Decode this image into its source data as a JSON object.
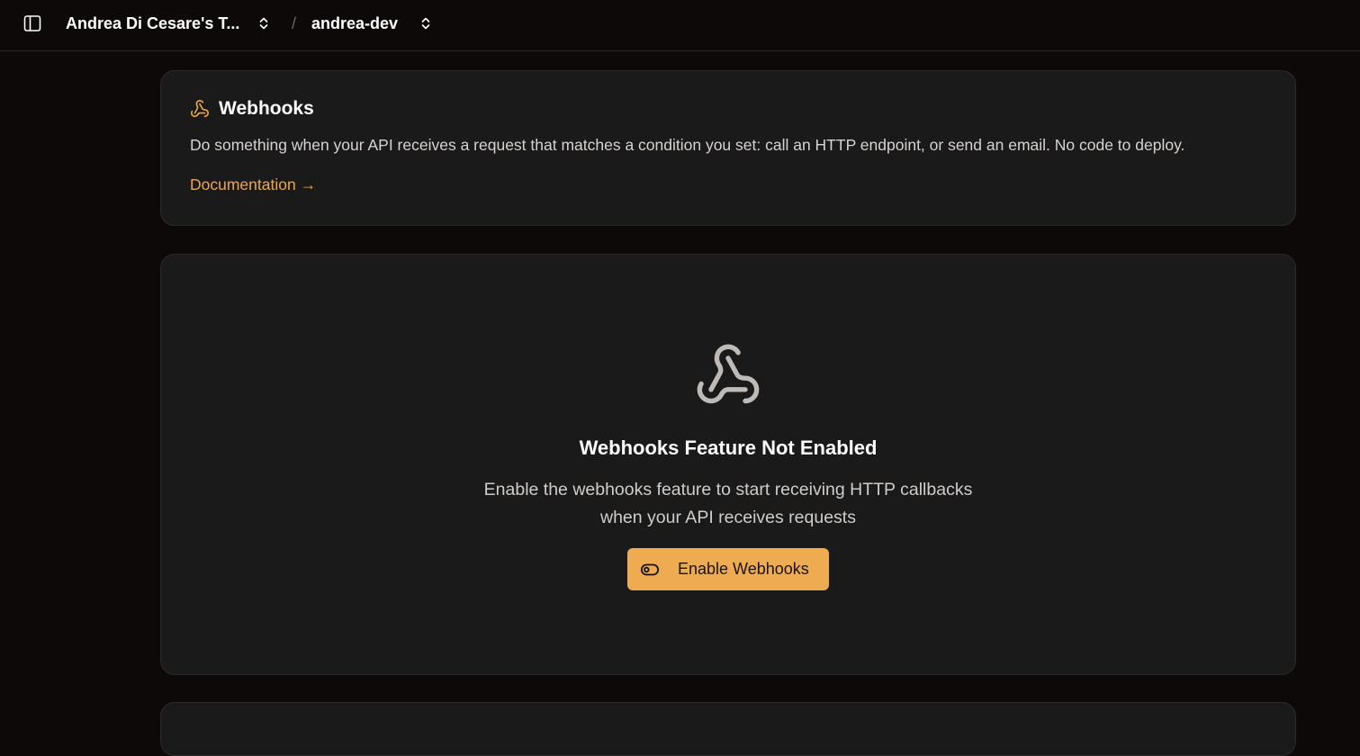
{
  "header": {
    "team_name": "Andrea Di Cesare's T...",
    "separator": "/",
    "project_name": "andrea-dev",
    "icons": [
      "sidebar-toggle-icon",
      "chevron-up-down-icon"
    ]
  },
  "info_card": {
    "title": "Webhooks",
    "description": "Do something when your API receives a request that matches a condition you set: call an HTTP endpoint, or send an email. No code to deploy.",
    "documentation_link": "Documentation →",
    "icon": "webhook-icon"
  },
  "empty_state": {
    "title": "Webhooks Feature Not Enabled",
    "description": "Enable the webhooks feature to start receiving HTTP callbacks when your API receives requests",
    "button_label": "Enable Webhooks",
    "icon": "webhook-icon",
    "button_icon": "toggle-icon"
  },
  "colors": {
    "background": "#0c0908",
    "card": "#1a1a1a",
    "accent": "#eeab51",
    "link": "#eba84b"
  }
}
